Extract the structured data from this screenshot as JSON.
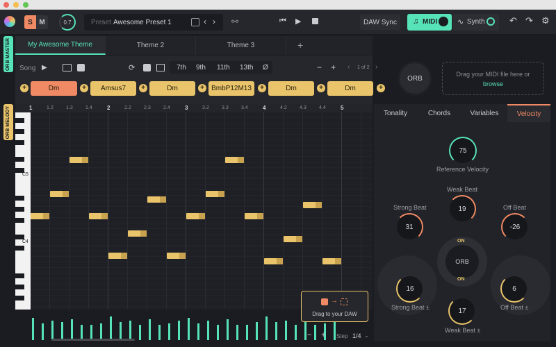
{
  "toolbar": {
    "mode_s": "S",
    "mode_m": "M",
    "tempo_knob": "0.7",
    "preset_label": "Preset",
    "preset_name": "Awesome Preset 1",
    "daw_sync": "DAW Sync",
    "midi": "MIDI",
    "synth": "Synth"
  },
  "sidebar": {
    "master": "ORB MASTER",
    "melody": "ORB MELODY"
  },
  "tabs": [
    "My Awesome Theme",
    "Theme 2",
    "Theme 3"
  ],
  "song_bar": {
    "song_label": "Song",
    "extensions": [
      "7th",
      "9th",
      "11th",
      "13th",
      "Ø"
    ],
    "page": "1 of 2"
  },
  "chords": [
    "Dm",
    "Amsus7",
    "Dm",
    "BmbP12M13",
    "Dm",
    "Dm"
  ],
  "orb_label": "ORB",
  "drop_zone": {
    "text": "Drag your MIDI file here or",
    "link": "browse"
  },
  "ruler": [
    "1",
    "1.2",
    "1.3",
    "1.4",
    "2",
    "2.2",
    "2.3",
    "2.4",
    "3",
    "3.2",
    "3.3",
    "3.4",
    "4",
    "4.2",
    "4.3",
    "4.4",
    "5"
  ],
  "keys": {
    "c5": "C5",
    "c4": "C4"
  },
  "drag_daw": "Drag to your DAW",
  "step": {
    "label": "Step",
    "value": "1/4"
  },
  "right_tabs": [
    "Tonality",
    "Chords",
    "Variables",
    "Velocity"
  ],
  "velocity": {
    "reference": {
      "value": "75",
      "label": "Reference Velocity"
    },
    "weak_beat": {
      "value": "19",
      "label": "Weak Beat"
    },
    "strong_beat": {
      "value": "31",
      "label": "Strong Beat"
    },
    "off_beat": {
      "value": "-26",
      "label": "Off Beat"
    },
    "orb": "ORB",
    "on_top": "ON",
    "on_bottom": "ON",
    "strong_beat_pm": {
      "value": "16",
      "label": "Strong Beat ±"
    },
    "off_beat_pm": {
      "value": "6",
      "label": "Off Beat ±"
    },
    "weak_beat_pm": {
      "value": "17",
      "label": "Weak Beat ±"
    }
  },
  "colors": {
    "accent": "#57e3b8",
    "chord": "#e9c46a",
    "chord_active": "#f08a64",
    "background": "#1b1c21"
  }
}
